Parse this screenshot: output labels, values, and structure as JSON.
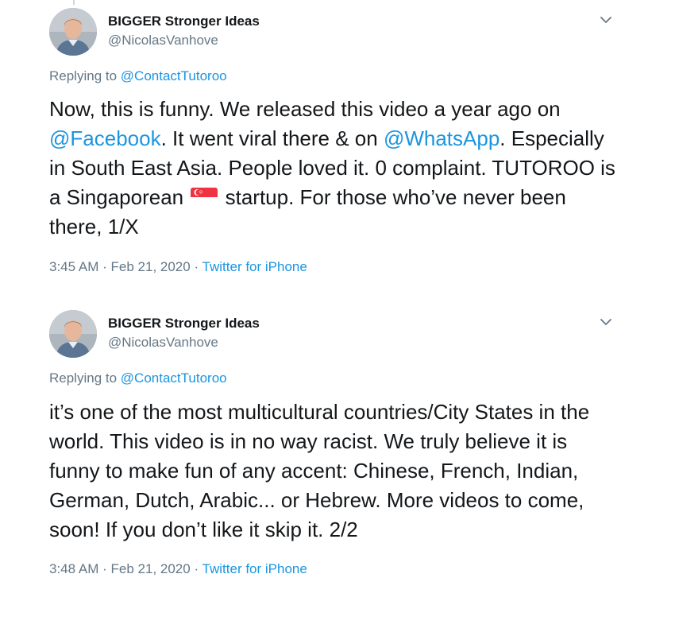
{
  "tweets": [
    {
      "author": {
        "name": "BIGGER Stronger Ideas",
        "handle": "@NicolasVanhove"
      },
      "replying_label": "Replying to",
      "replying_to": "@ContactTutoroo",
      "body": {
        "seg1": "Now, this is funny. We released this video a year ago on ",
        "mention1": "@Facebook",
        "seg2": ". It went viral there & on ",
        "mention2": "@WhatsApp",
        "seg3": ". Especially in South East Asia.  People loved it. 0 complaint. TUTOROO is a Singaporean ",
        "flag_icon": "singapore-flag",
        "seg4": " startup. For those who’ve never been there, 1/X"
      },
      "time": "3:45 AM",
      "date": "Feb 21, 2020",
      "separator": "·",
      "source": "Twitter for iPhone"
    },
    {
      "author": {
        "name": "BIGGER Stronger Ideas",
        "handle": "@NicolasVanhove"
      },
      "replying_label": "Replying to",
      "replying_to": "@ContactTutoroo",
      "body": {
        "text": "it’s one of the most multicultural countries/City States in the world. This video is in no way racist. We truly believe it is funny to make fun of any accent: Chinese, French, Indian, German, Dutch, Arabic... or Hebrew. More videos to come, soon! If you don’t like it skip it. 2/2"
      },
      "time": "3:48 AM",
      "date": "Feb 21, 2020",
      "separator": "·",
      "source": "Twitter for iPhone"
    }
  ],
  "icons": {
    "caret": "chevron-down-icon",
    "avatar": "avatar-photo"
  },
  "colors": {
    "link": "#1b95e0",
    "secondary_text": "#657786",
    "primary_text": "#14171a"
  }
}
